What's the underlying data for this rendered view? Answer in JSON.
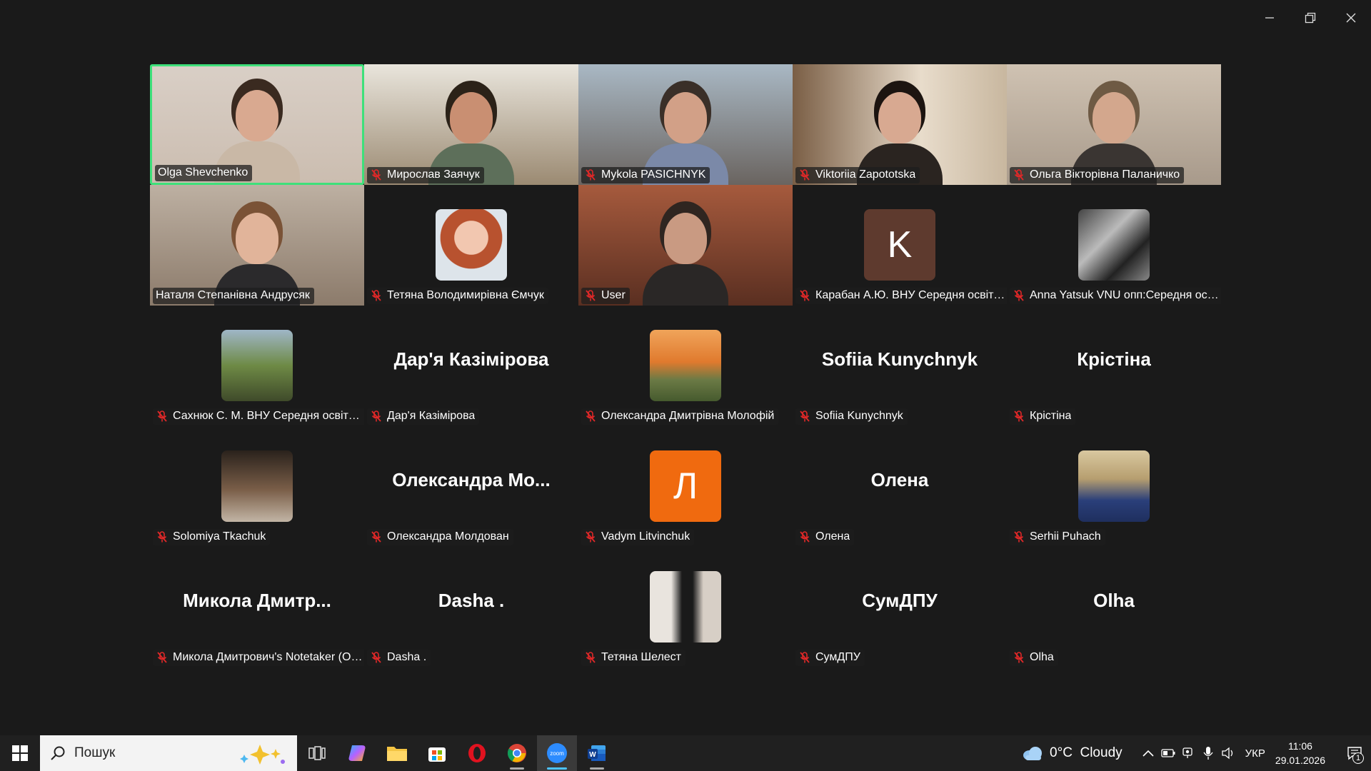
{
  "window": {
    "minimize_icon": "minimize-icon",
    "restore_icon": "restore-icon",
    "close_icon": "close-icon"
  },
  "participants": [
    {
      "name": "Olga Shevchenko",
      "kind": "video",
      "muted": false,
      "speaking": true
    },
    {
      "name": "Мирослав Заячук",
      "kind": "video",
      "muted": true
    },
    {
      "name": "Mykola PASICHNYK",
      "kind": "video",
      "muted": true
    },
    {
      "name": "Viktoriia Zapototska",
      "kind": "video",
      "muted": true
    },
    {
      "name": "Ольга Вікторівна Паланичко",
      "kind": "video",
      "muted": true
    },
    {
      "name": "Наталя Степанівна Андрусяк",
      "kind": "video",
      "muted": false
    },
    {
      "name": "Тетяна Володимирівна Ємчук",
      "kind": "photo",
      "muted": true
    },
    {
      "name": "User",
      "kind": "video",
      "muted": true
    },
    {
      "name": "Карабан А.Ю. ВНУ Середня освіта. Г...",
      "kind": "initial",
      "initial": "K",
      "muted": true
    },
    {
      "name": "Anna Yatsuk VNU опп:Середня освіт...",
      "kind": "photo",
      "muted": true
    },
    {
      "name": "Сахнюк С. М. ВНУ Середня освіта. Г...",
      "kind": "photo",
      "muted": true
    },
    {
      "name": "Дар'я Казімірова",
      "kind": "text",
      "display": "Дар'я Казімірова",
      "muted": true
    },
    {
      "name": "Олександра Дмитрівна Молофій",
      "kind": "photo",
      "muted": true
    },
    {
      "name": "Sofiia Kunychnyk",
      "kind": "text",
      "display": "Sofiia Kunychnyk",
      "muted": true
    },
    {
      "name": "Крістіна",
      "kind": "text",
      "display": "Крістіна",
      "muted": true
    },
    {
      "name": "Solomiya Tkachuk",
      "kind": "photo",
      "muted": true
    },
    {
      "name": "Олександра Молдован",
      "kind": "text",
      "display": "Олександра Мо...",
      "muted": true
    },
    {
      "name": "Vadym Litvinchuk",
      "kind": "initial",
      "initial": "Л",
      "muted": true
    },
    {
      "name": "Олена",
      "kind": "text",
      "display": "Олена",
      "muted": true
    },
    {
      "name": "Serhii Puhach",
      "kind": "photo",
      "muted": true
    },
    {
      "name": "Микола Дмитрович's Notetaker (Ott...",
      "kind": "text",
      "display": "Микола Дмитр...",
      "muted": true
    },
    {
      "name": "Dasha .",
      "kind": "text",
      "display": "Dasha .",
      "muted": true
    },
    {
      "name": "Тетяна Шелест",
      "kind": "photo",
      "muted": true
    },
    {
      "name": "СумДПУ",
      "kind": "text",
      "display": "СумДПУ",
      "muted": true
    },
    {
      "name": "Olha",
      "kind": "text",
      "display": "Olha",
      "muted": true
    }
  ],
  "taskbar": {
    "search_placeholder": "Пошук",
    "apps": [
      "start-icon",
      "task-view-icon",
      "copilot-icon",
      "file-explorer-icon",
      "microsoft-store-icon",
      "opera-icon",
      "chrome-icon",
      "zoom-icon",
      "word-icon"
    ],
    "weather": "0°C  Cloudy",
    "language": "УКР",
    "time": "11:06",
    "date": "29.01.2026",
    "notification_count": "1"
  },
  "colors": {
    "active_speaker": "#3ee07a",
    "background": "#1a1a1a",
    "muted_mic": "#e02828",
    "initial_K": "#5e3a2e",
    "initial_L": "#f06a0f"
  }
}
